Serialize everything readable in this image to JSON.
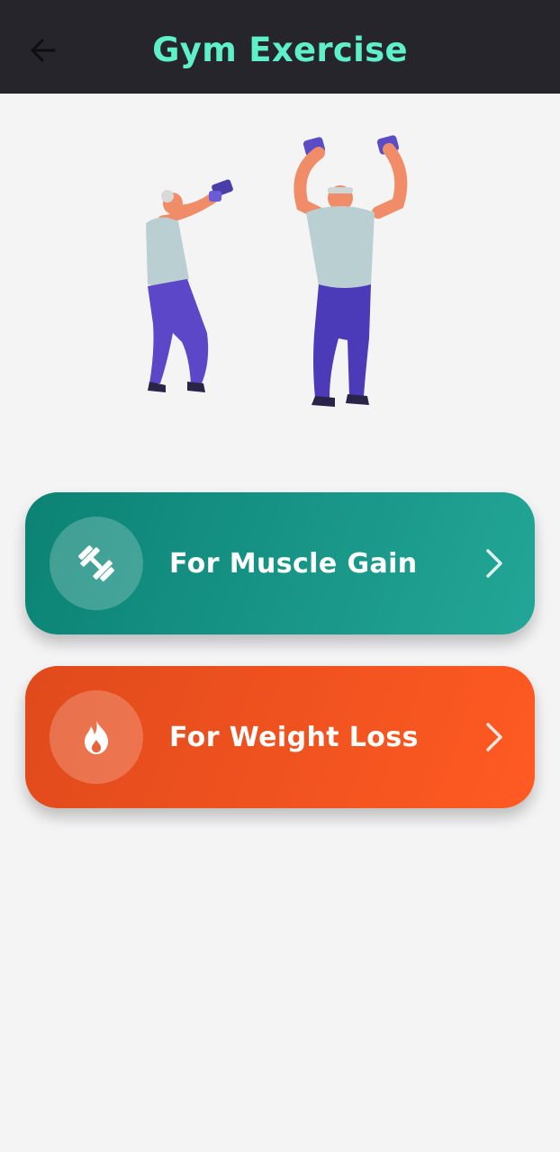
{
  "app_bar": {
    "title": "Gym Exercise",
    "title_color": "#5ef0c8",
    "background": "#26252c",
    "back_icon": "arrow-left-icon"
  },
  "hero": {
    "illustration": "two people lifting dumbbells"
  },
  "options": [
    {
      "label": "For Muscle Gain",
      "icon": "dumbbell-icon",
      "gradient": [
        "#0b8274",
        "#23a697"
      ],
      "chevron": "chevron-right-icon"
    },
    {
      "label": "For Weight Loss",
      "icon": "flame-icon",
      "gradient": [
        "#e04a1c",
        "#ff5a22"
      ],
      "chevron": "chevron-right-icon"
    }
  ]
}
